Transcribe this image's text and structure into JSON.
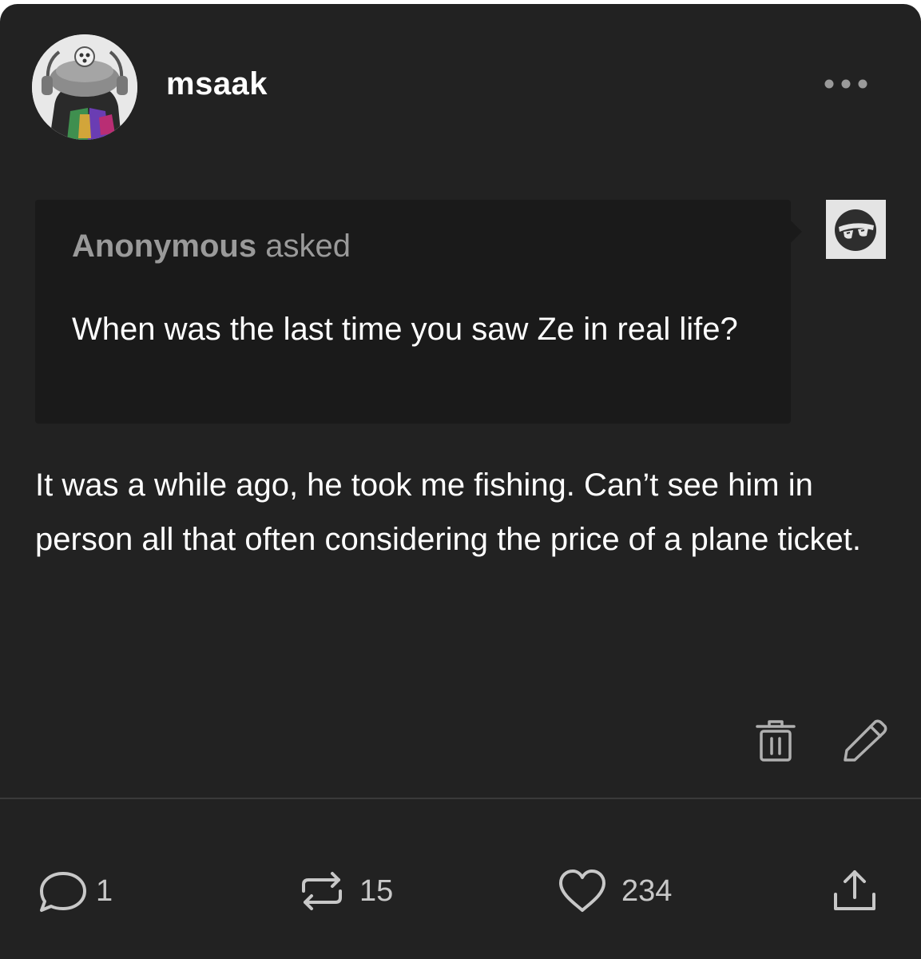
{
  "post": {
    "username": "msaak",
    "ask": {
      "asker": "Anonymous",
      "verb": "asked",
      "question": "When was the last time you saw Ze in real life?"
    },
    "answer": "It was a while ago, he took me fishing. Can’t see him in person all that often considering the price of a plane ticket."
  },
  "footer": {
    "replies": "1",
    "reblogs": "15",
    "likes": "234"
  },
  "icons": {
    "more": "more-horizontal-icon",
    "delete": "trash-icon",
    "edit": "pencil-icon",
    "reply": "speech-bubble-icon",
    "reblog": "reblog-icon",
    "like": "heart-icon",
    "share": "share-icon"
  },
  "colors": {
    "background": "#222222",
    "ask_background": "#1a1a1a",
    "text": "#ffffff",
    "muted_text": "#9a9a9a",
    "icon": "#c8c8c8"
  }
}
